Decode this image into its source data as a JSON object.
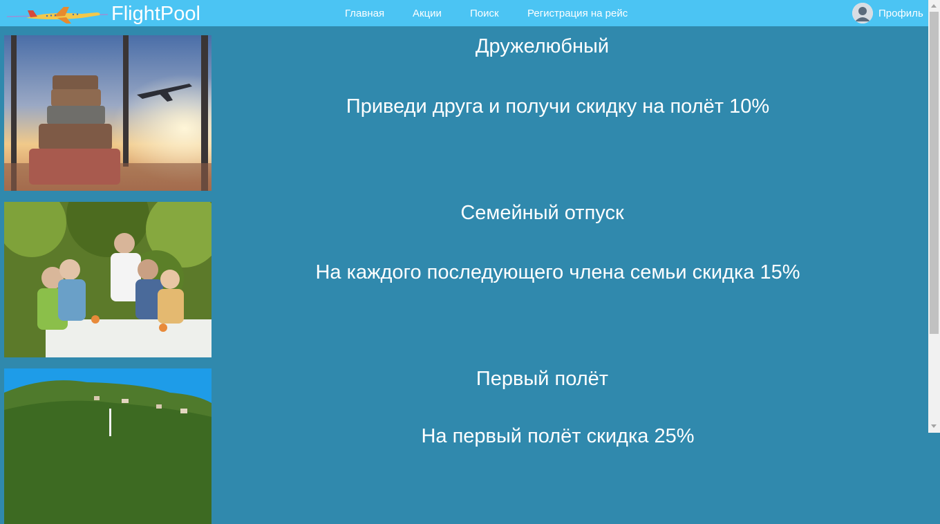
{
  "header": {
    "brand": "FlightPool",
    "nav": [
      "Главная",
      "Акции",
      "Поиск",
      "Регистрация на рейс"
    ],
    "profile_label": "Профиль",
    "colors": {
      "bar": "#4bc4f3",
      "page": "#3089ad",
      "text": "#ffffff"
    }
  },
  "promotions": [
    {
      "title": "Дружелюбный",
      "description": "Приведи друга и получи скидку на полёт 10%",
      "image": "suitcases-window-airplane-sunset"
    },
    {
      "title": "Семейный отпуск",
      "description": "На каждого последующего члена семьи скидка 15%",
      "image": "family-dinner-outdoors"
    },
    {
      "title": "Первый полёт",
      "description": "На первый полёт скидка 25%",
      "image": "green-hills-village"
    }
  ]
}
